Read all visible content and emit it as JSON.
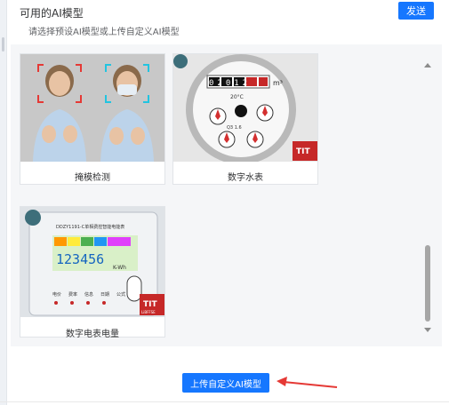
{
  "header": {
    "title": "可用的AI模型",
    "subtitle": "请选择预设AI模型或上传自定义AI模型",
    "send_label": "发送"
  },
  "models": [
    {
      "label": "掩模检测",
      "icon": "mask-detection-image"
    },
    {
      "label": "数字水表",
      "icon": "water-meter-image"
    },
    {
      "label": "数字电表电量",
      "icon": "electric-meter-image"
    }
  ],
  "meter": {
    "water_digits": "02012",
    "water_unit": "m³",
    "water_temp": "20°C",
    "water_class": "Q3 1.6",
    "elec_reading": "123456",
    "elec_unit": "K-Wh",
    "elec_title": "DDZY1191-C单相费控智能电能表",
    "elec_keys": [
      "电价",
      "费率",
      "信息",
      "日期",
      "公式"
    ],
    "license": "LiBFFSE"
  },
  "upload": {
    "label": "上传自定义AI模型"
  },
  "colors": {
    "primary": "#1677ff",
    "annotation_arrow": "#e53935"
  }
}
